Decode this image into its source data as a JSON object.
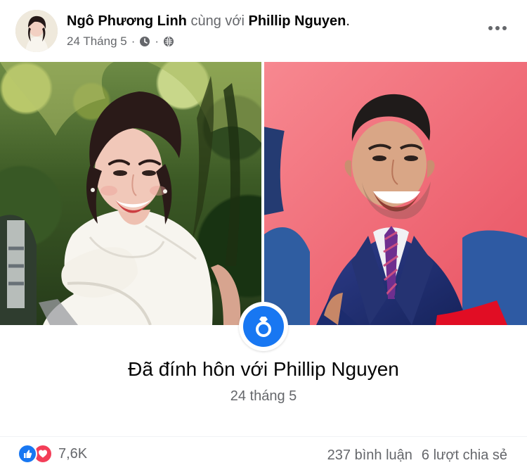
{
  "post": {
    "author": "Ngô Phương Linh",
    "with_text": "cùng với",
    "tagged_person": "Phillip Nguyen",
    "period": ".",
    "date": "24 Tháng 5",
    "meta_separator_1": "·",
    "meta_separator_2": "·",
    "icons": {
      "author_avatar": "avatar",
      "clock": "clock-icon",
      "globe": "globe-icon",
      "more": "more-options-icon",
      "ring": "ring-icon",
      "like": "like-icon",
      "love": "love-icon"
    }
  },
  "life_event": {
    "title": "Đã đính hôn với Phillip Nguyen",
    "date": "24 tháng 5"
  },
  "footer": {
    "reaction_count": "7,6K",
    "comments": "237 bình luận",
    "shares": "6 lượt chia sẻ"
  },
  "colors": {
    "facebook_blue": "#1877f2",
    "love_red": "#f33e58",
    "secondary_text": "#65676b",
    "primary_text": "#050505"
  }
}
